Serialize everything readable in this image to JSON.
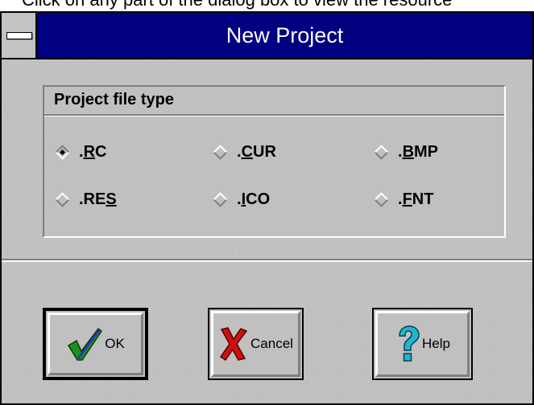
{
  "caption": "Click on any part of the dialog box to view the resource",
  "window": {
    "title": "New Project"
  },
  "group": {
    "title": "Project file type",
    "options": [
      {
        "label_pre": ".",
        "label_ul": "R",
        "label_post": "C",
        "checked": true
      },
      {
        "label_pre": ".",
        "label_ul": "C",
        "label_post": "UR",
        "checked": false
      },
      {
        "label_pre": ".",
        "label_ul": "B",
        "label_post": "MP",
        "checked": false
      },
      {
        "label_pre": ".RE",
        "label_ul": "S",
        "label_post": "",
        "checked": false
      },
      {
        "label_pre": ".",
        "label_ul": "I",
        "label_post": "CO",
        "checked": false
      },
      {
        "label_pre": ".",
        "label_ul": "F",
        "label_post": "NT",
        "checked": false
      }
    ]
  },
  "buttons": {
    "ok": {
      "label": "OK",
      "icon": "checkmark-icon"
    },
    "cancel": {
      "label": "Cancel",
      "icon": "x-icon"
    },
    "help": {
      "label": "Help",
      "icon": "question-mark-icon"
    }
  },
  "colors": {
    "titlebar": "#000080",
    "face": "#c0c0c0",
    "check_green": "#1c8f1c",
    "cancel_red": "#d01010",
    "help_cyan": "#1fb8c8"
  }
}
